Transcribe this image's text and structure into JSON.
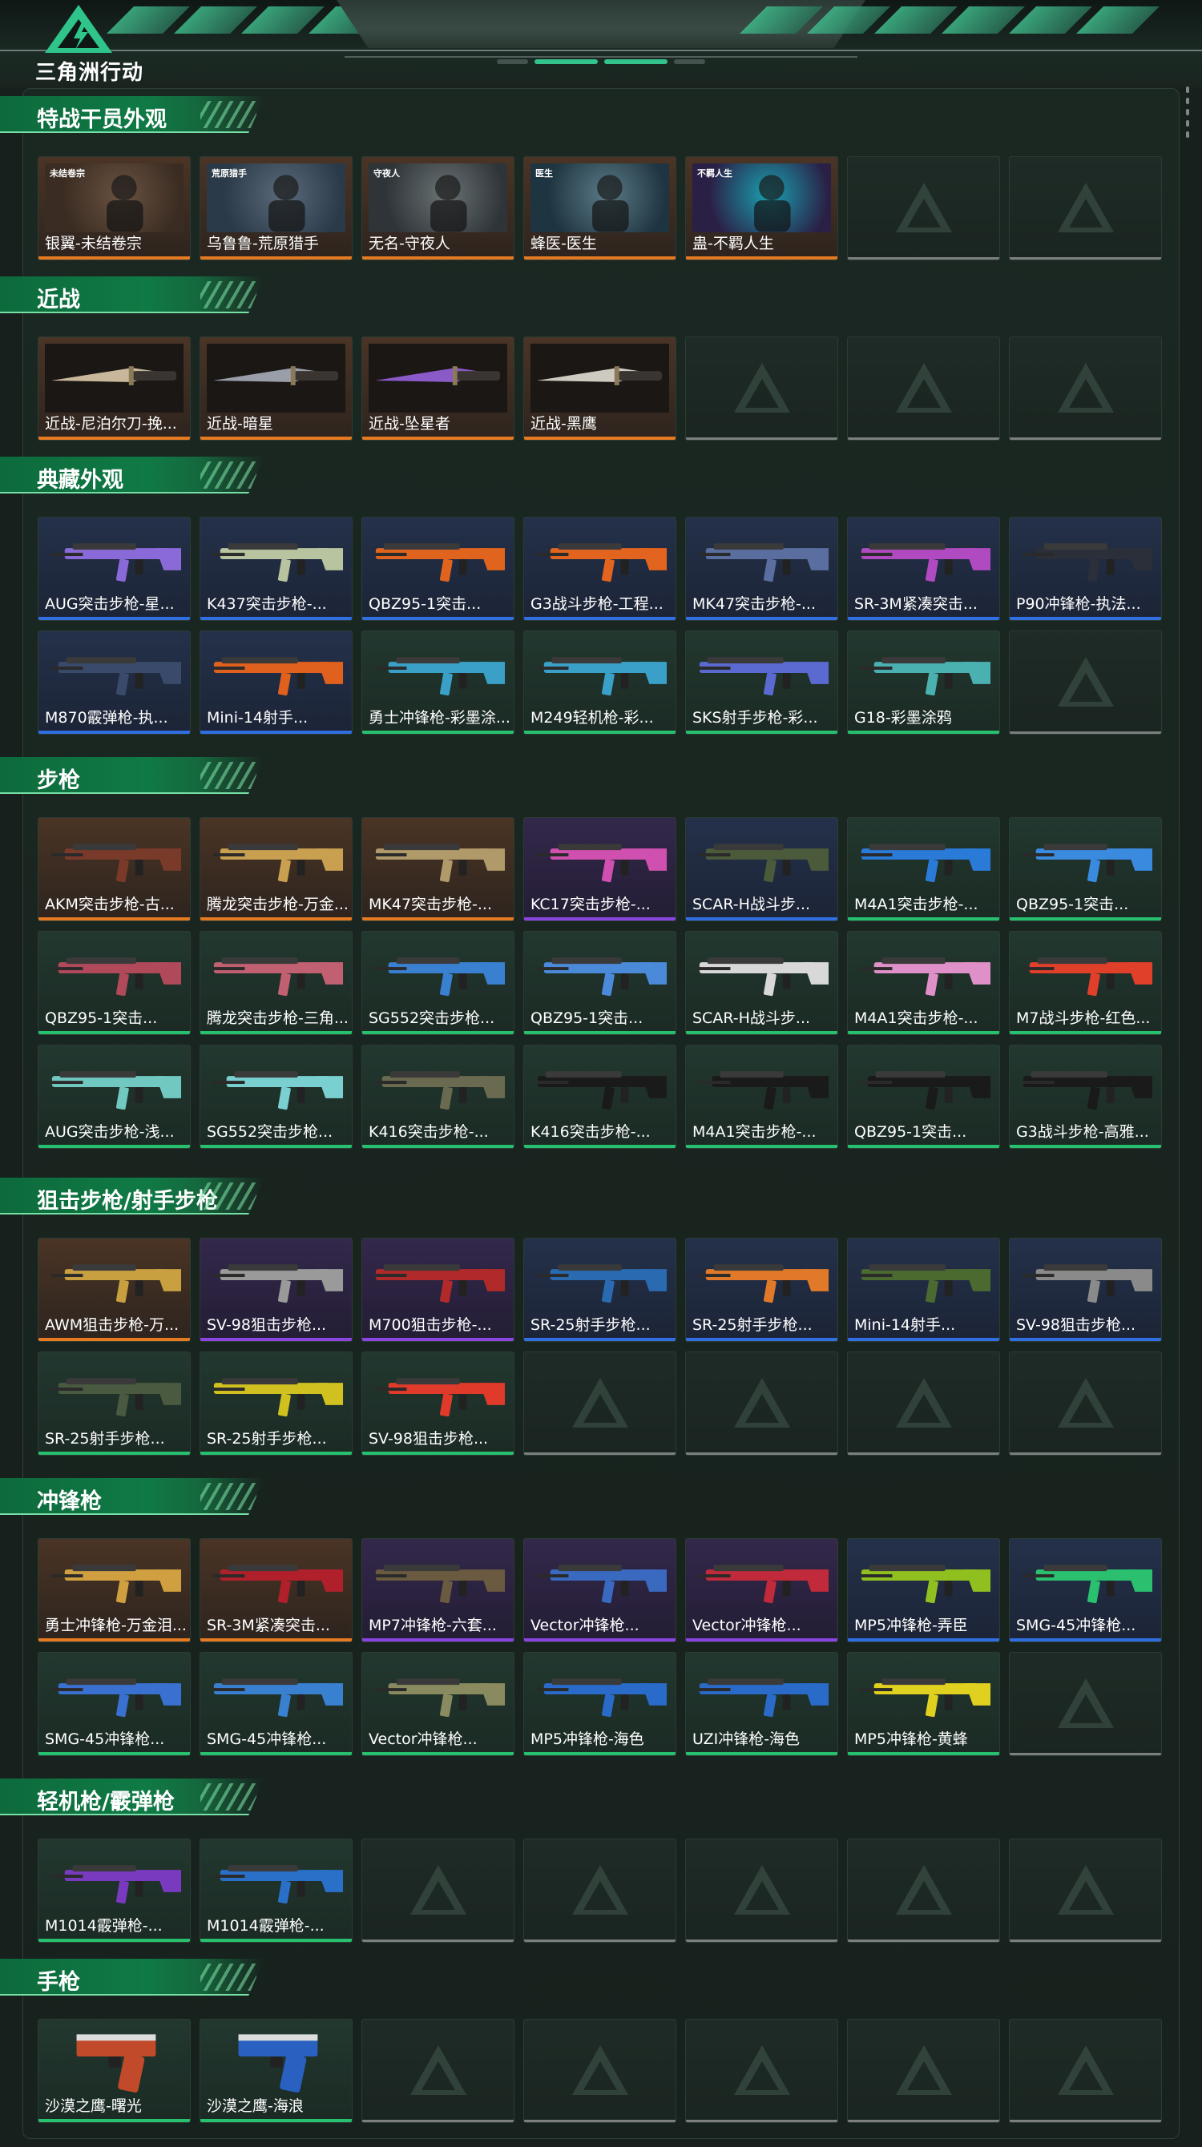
{
  "header": {
    "logo_text": "三角洲行动",
    "brand_color": "#33c38c"
  },
  "sections": [
    {
      "title": "特战干员外观",
      "items": [
        {
          "name": "银翼-未结卷宗",
          "rarity": "orange",
          "kind": "operator",
          "tag": "未结卷宗"
        },
        {
          "name": "乌鲁鲁-荒原猎手",
          "rarity": "orange",
          "kind": "operator",
          "tag": "荒原猎手"
        },
        {
          "name": "无名-守夜人",
          "rarity": "orange",
          "kind": "operator",
          "tag": "守夜人"
        },
        {
          "name": "蜂医-医生",
          "rarity": "orange",
          "kind": "operator",
          "tag": "医生"
        },
        {
          "name": "蛊-不羁人生",
          "rarity": "orange",
          "kind": "operator",
          "tag": "不羁人生"
        },
        {
          "name": "",
          "rarity": "empty"
        },
        {
          "name": "",
          "rarity": "empty"
        }
      ]
    },
    {
      "title": "近战",
      "items": [
        {
          "name": "近战-尼泊尔刀-挽...",
          "rarity": "orange",
          "kind": "knife",
          "color": "#c8b79a"
        },
        {
          "name": "近战-暗星",
          "rarity": "orange",
          "kind": "knife",
          "color": "#9a9ea8"
        },
        {
          "name": "近战-坠星者",
          "rarity": "orange",
          "kind": "knife",
          "color": "#8b5ac9"
        },
        {
          "name": "近战-黑鹰",
          "rarity": "orange",
          "kind": "knife",
          "color": "#cfcac0"
        },
        {
          "name": "",
          "rarity": "empty"
        },
        {
          "name": "",
          "rarity": "empty"
        },
        {
          "name": "",
          "rarity": "empty"
        }
      ]
    },
    {
      "title": "典藏外观",
      "items": [
        {
          "name": "AUG突击步枪-星...",
          "rarity": "blue",
          "kind": "gun",
          "color": "#8a6ad8"
        },
        {
          "name": "K437突击步枪-...",
          "rarity": "blue",
          "kind": "gun",
          "color": "#b8c4a0"
        },
        {
          "name": "QBZ95-1突击...",
          "rarity": "blue",
          "kind": "gun",
          "color": "#e0641e"
        },
        {
          "name": "G3战斗步枪-工程...",
          "rarity": "blue",
          "kind": "gun",
          "color": "#e2641e"
        },
        {
          "name": "MK47突击步枪-...",
          "rarity": "blue",
          "kind": "gun",
          "color": "#5a6fa0"
        },
        {
          "name": "SR-3M紧凑突击...",
          "rarity": "blue",
          "kind": "gun",
          "color": "#b04ac0"
        },
        {
          "name": "P90冲锋枪-执法...",
          "rarity": "blue",
          "kind": "gun",
          "color": "#2a2f3a"
        },
        {
          "name": "M870霰弹枪-执...",
          "rarity": "blue",
          "kind": "gun",
          "color": "#3a4a6a"
        },
        {
          "name": "Mini-14射手...",
          "rarity": "blue",
          "kind": "gun",
          "color": "#e0601e"
        },
        {
          "name": "勇士冲锋枪-彩墨涂...",
          "rarity": "green",
          "kind": "gun",
          "color": "#3aa0c8"
        },
        {
          "name": "M249轻机枪-彩...",
          "rarity": "green",
          "kind": "gun",
          "color": "#3aa0c8"
        },
        {
          "name": "SKS射手步枪-彩...",
          "rarity": "green",
          "kind": "gun",
          "color": "#5a6ad0"
        },
        {
          "name": "G18-彩墨涂鸦",
          "rarity": "green",
          "kind": "gun",
          "color": "#4ab0b0"
        },
        {
          "name": "",
          "rarity": "empty"
        }
      ]
    },
    {
      "title": "步枪",
      "items": [
        {
          "name": "AKM突击步枪-古...",
          "rarity": "orange",
          "kind": "gun",
          "color": "#7a3a2a"
        },
        {
          "name": "腾龙突击步枪-万金...",
          "rarity": "orange",
          "kind": "gun",
          "color": "#c8a050"
        },
        {
          "name": "MK47突击步枪-...",
          "rarity": "orange",
          "kind": "gun",
          "color": "#b09a6a"
        },
        {
          "name": "KC17突击步枪-...",
          "rarity": "purple",
          "kind": "gun",
          "color": "#d050b0"
        },
        {
          "name": "SCAR-H战斗步...",
          "rarity": "blue",
          "kind": "gun",
          "color": "#4a5a3a"
        },
        {
          "name": "M4A1突击步枪-...",
          "rarity": "green",
          "kind": "gun",
          "color": "#2a7ad8"
        },
        {
          "name": "QBZ95-1突击...",
          "rarity": "green",
          "kind": "gun",
          "color": "#3a8ae0"
        },
        {
          "name": "QBZ95-1突击...",
          "rarity": "green",
          "kind": "gun",
          "color": "#b04a5a"
        },
        {
          "name": "腾龙突击步枪-三角...",
          "rarity": "green",
          "kind": "gun",
          "color": "#c06070"
        },
        {
          "name": "SG552突击步枪...",
          "rarity": "green",
          "kind": "gun",
          "color": "#3a80d0"
        },
        {
          "name": "QBZ95-1突击...",
          "rarity": "green",
          "kind": "gun",
          "color": "#4a8ad8"
        },
        {
          "name": "SCAR-H战斗步...",
          "rarity": "green",
          "kind": "gun",
          "color": "#d8d8d8"
        },
        {
          "name": "M4A1突击步枪-...",
          "rarity": "green",
          "kind": "gun",
          "color": "#e090c8"
        },
        {
          "name": "M7战斗步枪-红色...",
          "rarity": "green",
          "kind": "gun",
          "color": "#e0402a"
        },
        {
          "name": "AUG突击步枪-浅...",
          "rarity": "green",
          "kind": "gun",
          "color": "#70c8c0"
        },
        {
          "name": "SG552突击步枪...",
          "rarity": "green",
          "kind": "gun",
          "color": "#7ad0d0"
        },
        {
          "name": "K416突击步枪-...",
          "rarity": "green",
          "kind": "gun",
          "color": "#6a6a50"
        },
        {
          "name": "K416突击步枪-...",
          "rarity": "green",
          "kind": "gun",
          "color": "#1a1a1a"
        },
        {
          "name": "M4A1突击步枪-...",
          "rarity": "green",
          "kind": "gun",
          "color": "#1a1a1a"
        },
        {
          "name": "QBZ95-1突击...",
          "rarity": "green",
          "kind": "gun",
          "color": "#1a1a1a"
        },
        {
          "name": "G3战斗步枪-高雅...",
          "rarity": "green",
          "kind": "gun",
          "color": "#1a1a1a"
        }
      ]
    },
    {
      "title": "狙击步枪/射手步枪",
      "items": [
        {
          "name": "AWM狙击步枪-万...",
          "rarity": "orange",
          "kind": "gun",
          "color": "#c8a040"
        },
        {
          "name": "SV-98狙击步枪...",
          "rarity": "purple",
          "kind": "gun",
          "color": "#9a9a9a"
        },
        {
          "name": "M700狙击步枪-...",
          "rarity": "purple",
          "kind": "gun",
          "color": "#b02a2a"
        },
        {
          "name": "SR-25射手步枪...",
          "rarity": "blue",
          "kind": "gun",
          "color": "#2a6ab0"
        },
        {
          "name": "SR-25射手步枪...",
          "rarity": "blue",
          "kind": "gun",
          "color": "#e07a2a"
        },
        {
          "name": "Mini-14射手...",
          "rarity": "blue",
          "kind": "gun",
          "color": "#4a6a30"
        },
        {
          "name": "SV-98狙击步枪...",
          "rarity": "blue",
          "kind": "gun",
          "color": "#8a8a8a"
        },
        {
          "name": "SR-25射手步枪...",
          "rarity": "green",
          "kind": "gun",
          "color": "#4a5a40"
        },
        {
          "name": "SR-25射手步枪...",
          "rarity": "green",
          "kind": "gun",
          "color": "#d0c020"
        },
        {
          "name": "SV-98狙击步枪...",
          "rarity": "green",
          "kind": "gun",
          "color": "#e03a2a"
        },
        {
          "name": "",
          "rarity": "empty"
        },
        {
          "name": "",
          "rarity": "empty"
        },
        {
          "name": "",
          "rarity": "empty"
        },
        {
          "name": "",
          "rarity": "empty"
        }
      ]
    },
    {
      "title": "冲锋枪",
      "items": [
        {
          "name": "勇士冲锋枪-万金泪...",
          "rarity": "orange",
          "kind": "gun",
          "color": "#d0a040"
        },
        {
          "name": "SR-3M紧凑突击...",
          "rarity": "orange",
          "kind": "gun",
          "color": "#b0202a"
        },
        {
          "name": "MP7冲锋枪-六套...",
          "rarity": "purple",
          "kind": "gun",
          "color": "#6a5a40"
        },
        {
          "name": "Vector冲锋枪...",
          "rarity": "purple",
          "kind": "gun",
          "color": "#3a6ac0"
        },
        {
          "name": "Vector冲锋枪...",
          "rarity": "purple",
          "kind": "gun",
          "color": "#c02a3a"
        },
        {
          "name": "MP5冲锋枪-弄臣",
          "rarity": "blue",
          "kind": "gun",
          "color": "#90c020"
        },
        {
          "name": "SMG-45冲锋枪...",
          "rarity": "blue",
          "kind": "gun",
          "color": "#2ac070"
        },
        {
          "name": "SMG-45冲锋枪...",
          "rarity": "green",
          "kind": "gun",
          "color": "#3a70d0"
        },
        {
          "name": "SMG-45冲锋枪...",
          "rarity": "green",
          "kind": "gun",
          "color": "#3a80d0"
        },
        {
          "name": "Vector冲锋枪...",
          "rarity": "green",
          "kind": "gun",
          "color": "#8a8a60"
        },
        {
          "name": "MP5冲锋枪-海色",
          "rarity": "green",
          "kind": "gun",
          "color": "#2a6ac8"
        },
        {
          "name": "UZI冲锋枪-海色",
          "rarity": "green",
          "kind": "gun",
          "color": "#2a6ac8"
        },
        {
          "name": "MP5冲锋枪-黄蜂",
          "rarity": "green",
          "kind": "gun",
          "color": "#e0d020"
        },
        {
          "name": "",
          "rarity": "empty"
        }
      ]
    },
    {
      "title": "轻机枪/霰弹枪",
      "items": [
        {
          "name": "M1014霰弹枪-...",
          "rarity": "green",
          "kind": "gun",
          "color": "#7a3ac0"
        },
        {
          "name": "M1014霰弹枪-...",
          "rarity": "green",
          "kind": "gun",
          "color": "#2a70c8"
        },
        {
          "name": "",
          "rarity": "empty"
        },
        {
          "name": "",
          "rarity": "empty"
        },
        {
          "name": "",
          "rarity": "empty"
        },
        {
          "name": "",
          "rarity": "empty"
        },
        {
          "name": "",
          "rarity": "empty"
        }
      ]
    },
    {
      "title": "手枪",
      "items": [
        {
          "name": "沙漠之鹰-曙光",
          "rarity": "green",
          "kind": "pistol",
          "color": "#c04a2a"
        },
        {
          "name": "沙漠之鹰-海浪",
          "rarity": "green",
          "kind": "pistol",
          "color": "#2a60c0"
        },
        {
          "name": "",
          "rarity": "empty"
        },
        {
          "name": "",
          "rarity": "empty"
        },
        {
          "name": "",
          "rarity": "empty"
        },
        {
          "name": "",
          "rarity": "empty"
        },
        {
          "name": "",
          "rarity": "empty"
        }
      ]
    }
  ]
}
